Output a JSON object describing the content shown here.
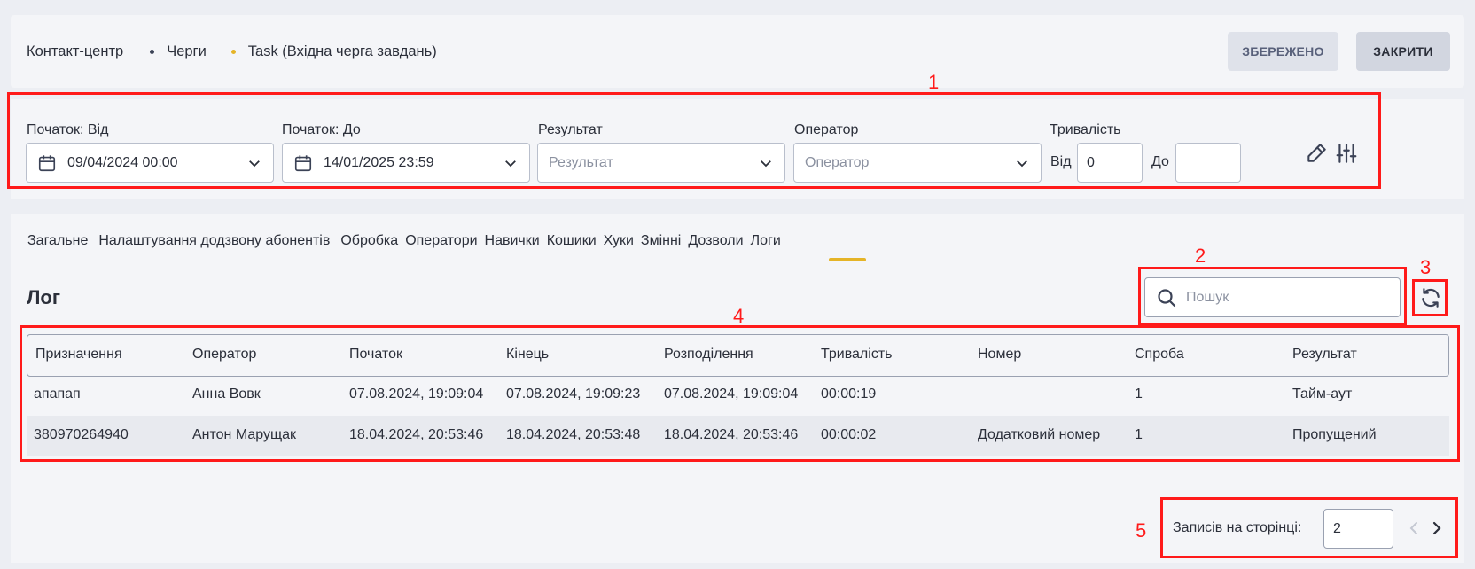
{
  "header": {
    "breadcrumb": [
      "Контакт-центр",
      "Черги",
      "Task (Вхідна черга завдань)"
    ],
    "saved_label": "ЗБЕРЕЖЕНО",
    "close_label": "ЗАКРИТИ"
  },
  "filters": {
    "start_from_label": "Початок: Від",
    "start_from_value": "09/04/2024 00:00",
    "start_to_label": "Початок: До",
    "start_to_value": "14/01/2025 23:59",
    "result_label": "Результат",
    "result_placeholder": "Результат",
    "operator_label": "Оператор",
    "operator_placeholder": "Оператор",
    "duration_label": "Тривалість",
    "duration_from_label": "Від",
    "duration_from_value": "0",
    "duration_to_label": "До",
    "duration_to_value": ""
  },
  "tabs": [
    "Загальне",
    "Налаштування додзвону абонентів",
    "Обробка",
    "Оператори",
    "Навички",
    "Кошики",
    "Хуки",
    "Змінні",
    "Дозволи",
    "Логи"
  ],
  "active_tab": "Логи",
  "log": {
    "title": "Лог",
    "search_placeholder": "Пошук",
    "columns": [
      "Призначення",
      "Оператор",
      "Початок",
      "Кінець",
      "Розподілення",
      "Тривалість",
      "Номер",
      "Спроба",
      "Результат"
    ],
    "rows": [
      [
        "апапап",
        "Анна Вовк",
        "07.08.2024, 19:09:04",
        "07.08.2024, 19:09:23",
        "07.08.2024, 19:09:04",
        "00:00:19",
        "",
        "1",
        "Тайм-аут"
      ],
      [
        "380970264940",
        "Антон Марущак",
        "18.04.2024, 20:53:46",
        "18.04.2024, 20:53:48",
        "18.04.2024, 20:53:46",
        "00:00:02",
        "Додатковий номер",
        "1",
        "Пропущений"
      ]
    ]
  },
  "pagination": {
    "per_page_label": "Записів на сторінці:",
    "per_page_value": "2"
  },
  "annotations": [
    "1",
    "2",
    "3",
    "4",
    "5"
  ],
  "colors": {
    "accent": "#e5b427",
    "annotation": "#ff1a1a",
    "background": "#eceef3",
    "card": "#f4f5f8"
  }
}
